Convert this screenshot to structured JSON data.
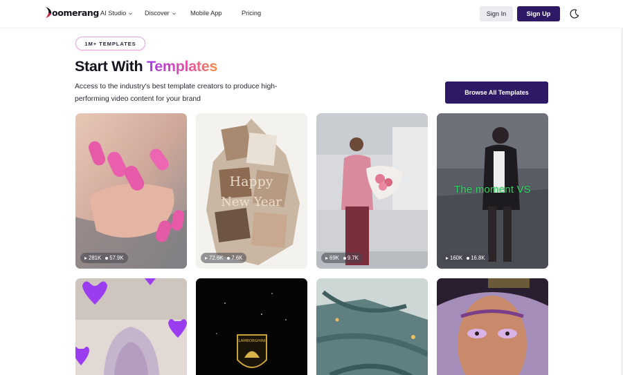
{
  "nav": {
    "logo_text": "oomerang",
    "items": [
      {
        "label": "AI Studio",
        "has_dropdown": true
      },
      {
        "label": "Discover",
        "has_dropdown": true
      },
      {
        "label": "Mobile App",
        "has_dropdown": false
      },
      {
        "label": "Pricing",
        "has_dropdown": false
      }
    ],
    "sign_in": "Sign In",
    "sign_up": "Sign Up",
    "theme_icon": "moon-icon"
  },
  "hero": {
    "badge": "1M+ TEMPLATES",
    "title_plain": "Start With ",
    "title_highlight": "Templates",
    "subtitle": "Access to the industry's best template creators to produce high-performing video content for your brand",
    "browse_button": "Browse All Templates"
  },
  "templates": [
    {
      "views": "281K",
      "likes": "57.9K",
      "overlay": ""
    },
    {
      "views": "72.6K",
      "likes": "7.6K",
      "overlay": ""
    },
    {
      "views": "69K",
      "likes": "9.7K",
      "overlay": ""
    },
    {
      "views": "160K",
      "likes": "16.8K",
      "overlay": "The moment VS"
    },
    {
      "views": "",
      "likes": "",
      "overlay": ""
    },
    {
      "views": "",
      "likes": "",
      "overlay": ""
    },
    {
      "views": "",
      "likes": "",
      "overlay": ""
    },
    {
      "views": "",
      "likes": "",
      "overlay": ""
    }
  ],
  "colors": {
    "brand": "#2e1966",
    "gradient": [
      "#a23dea",
      "#e54da6",
      "#f38a4a"
    ],
    "overlay_green": "#2fd85f"
  }
}
